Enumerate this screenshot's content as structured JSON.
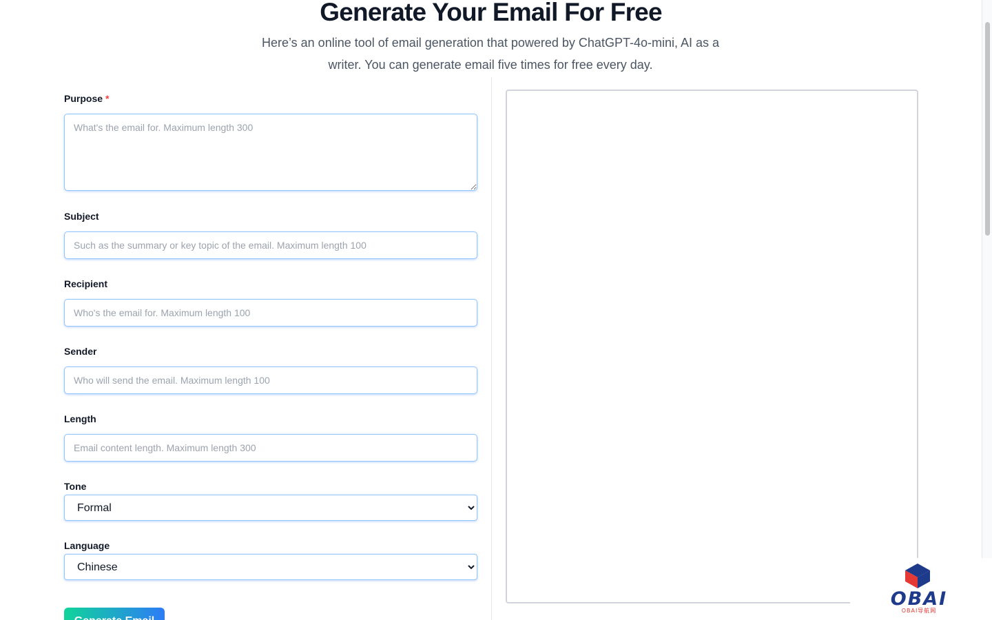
{
  "hero": {
    "title": "Generate Your Email For Free",
    "subtitle": "Here’s an online tool of email generation that powered by ChatGPT-4o-mini, AI as a writer. You can generate email five times for free every day."
  },
  "form": {
    "purpose": {
      "label": "Purpose",
      "required_mark": "*",
      "placeholder": "What's the email for. Maximum length 300",
      "value": ""
    },
    "subject": {
      "label": "Subject",
      "placeholder": "Such as the summary or key topic of the email. Maximum length 100",
      "value": ""
    },
    "recipient": {
      "label": "Recipient",
      "placeholder": "Who's the email for. Maximum length 100",
      "value": ""
    },
    "sender": {
      "label": "Sender",
      "placeholder": "Who will send the email. Maximum length 100",
      "value": ""
    },
    "length": {
      "label": "Length",
      "placeholder": "Email content length. Maximum length 300",
      "value": ""
    },
    "tone": {
      "label": "Tone",
      "selected": "Formal"
    },
    "language": {
      "label": "Language",
      "selected": "Chinese"
    },
    "submit_label": "Generate Email"
  },
  "output": {
    "content": ""
  },
  "watermark": {
    "brand": "OBAI",
    "subtext": "OBAI导航网"
  },
  "colors": {
    "required": "#ef4444",
    "input_border": "#93c5fd",
    "button_gradient_start": "#10d49a",
    "button_gradient_end": "#2d7cf6",
    "watermark_blue": "#1e3a8a",
    "watermark_red": "#e53935"
  },
  "icons": {
    "select_arrow": "chevron-down-icon",
    "logo": "cube-logo-icon"
  }
}
